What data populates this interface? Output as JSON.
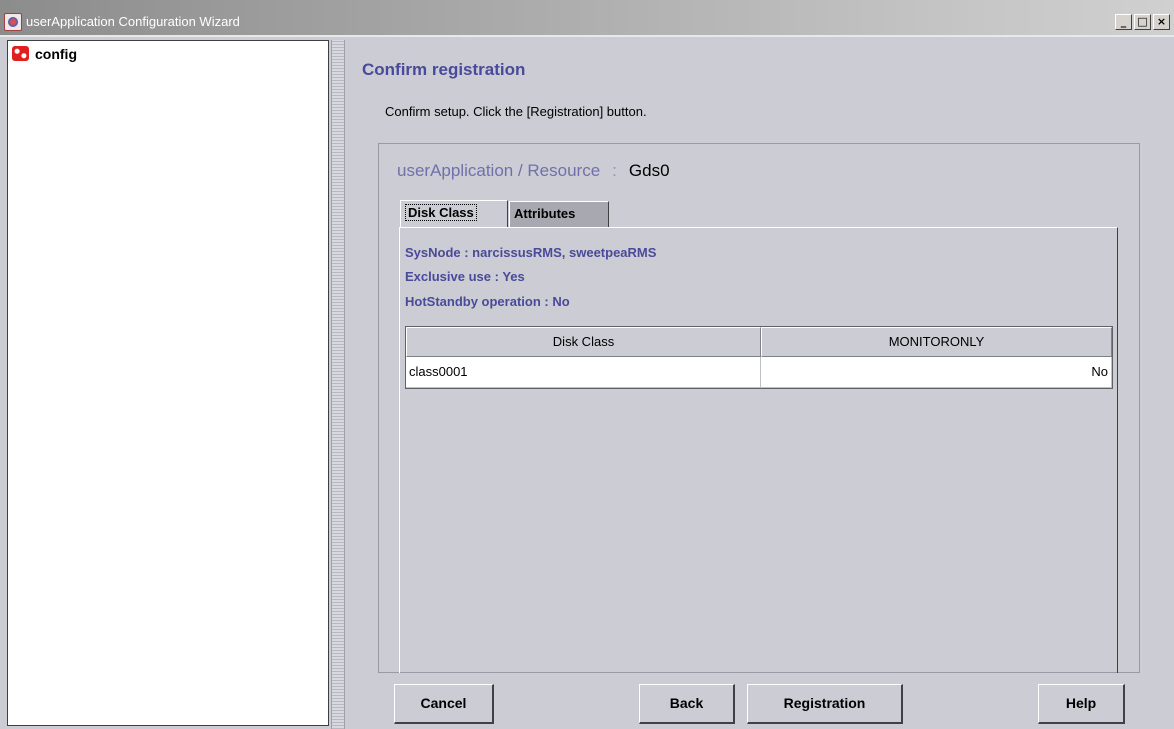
{
  "window": {
    "title": "userApplication Configuration Wizard",
    "buttons": {
      "minimize": "_",
      "maximize": "□",
      "close": "×"
    }
  },
  "tree": {
    "items": [
      {
        "label": "config",
        "icon": "config-node-icon"
      }
    ]
  },
  "page": {
    "title": "Confirm registration",
    "instructions": "Confirm setup.  Click the [Registration] button.",
    "resource_label": "userApplication / Resource",
    "resource_separator": ":",
    "resource_value": "Gds0"
  },
  "tabs": [
    {
      "label": "Disk Class",
      "active": true
    },
    {
      "label": "Attributes",
      "active": false
    }
  ],
  "details": {
    "sysnode": "SysNode : narcissusRMS, sweetpeaRMS",
    "exclusive": "Exclusive use : Yes",
    "hotstandby": "HotStandby operation : No"
  },
  "table": {
    "headers": [
      "Disk Class",
      "MONITORONLY"
    ],
    "rows": [
      [
        "class0001",
        "No"
      ]
    ]
  },
  "buttons": {
    "cancel": "Cancel",
    "back": "Back",
    "registration": "Registration",
    "help": "Help"
  },
  "colors": {
    "heading": "#4a4a9a",
    "resource_label": "#7070aa",
    "background": "#ccccd4"
  }
}
